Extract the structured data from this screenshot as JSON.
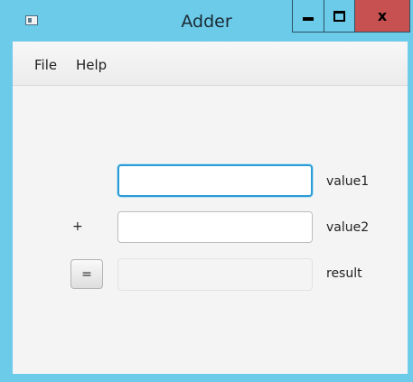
{
  "window": {
    "title": "Adder",
    "controls": {
      "minimize_icon": "minimize-icon",
      "maximize_icon": "maximize-icon",
      "close_label": "x"
    },
    "colors": {
      "frame": "#6ccbe9",
      "close_button": "#c75050",
      "focus_ring": "#2b9bd6"
    }
  },
  "menubar": {
    "items": [
      {
        "label": "File"
      },
      {
        "label": "Help"
      }
    ]
  },
  "form": {
    "value1": {
      "value": "",
      "label": "value1"
    },
    "value2": {
      "value": "",
      "label": "value2",
      "operator": "+"
    },
    "result": {
      "value": "",
      "label": "result"
    },
    "equals_button": {
      "label": "="
    }
  }
}
